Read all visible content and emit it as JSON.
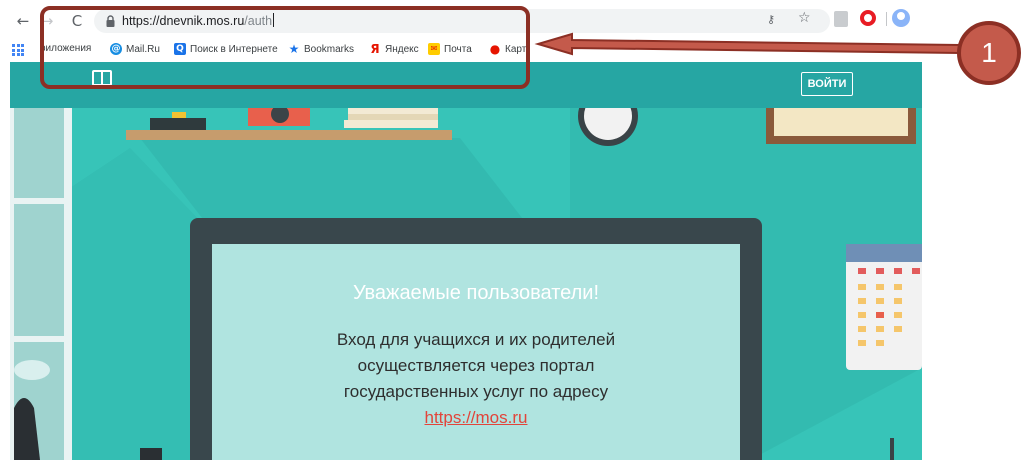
{
  "browser": {
    "url_host": "https://dnevnik.mos.ru",
    "url_path": "/auth",
    "bookmarks": [
      {
        "label": "риложения",
        "icon": "apps-icon"
      },
      {
        "label": "Mail.Ru",
        "icon": "mailru-icon"
      },
      {
        "label": "Поиск в Интернете",
        "icon": "search-icon"
      },
      {
        "label": "Bookmarks",
        "icon": "star-icon"
      },
      {
        "label": "Яндекс",
        "icon": "yandex-icon"
      },
      {
        "label": "Почта",
        "icon": "mail-envelope-icon"
      },
      {
        "label": "Карт",
        "icon": "map-pin-icon"
      }
    ]
  },
  "site": {
    "login_label": "ВОЙТИ",
    "notice": {
      "title": "Уважаемые пользователи!",
      "line1": "Вход для учащихся и их родителей",
      "line2": "осуществляется через портал",
      "line3": "государственных услуг по адресу",
      "link": "https://mos.ru"
    }
  },
  "annotation": {
    "badge": "1"
  },
  "colors": {
    "header": "#26a6a3",
    "hero": "#37c4b8",
    "callout": "#8c2f24",
    "badge": "#c45a4b",
    "link": "#e2443a"
  }
}
